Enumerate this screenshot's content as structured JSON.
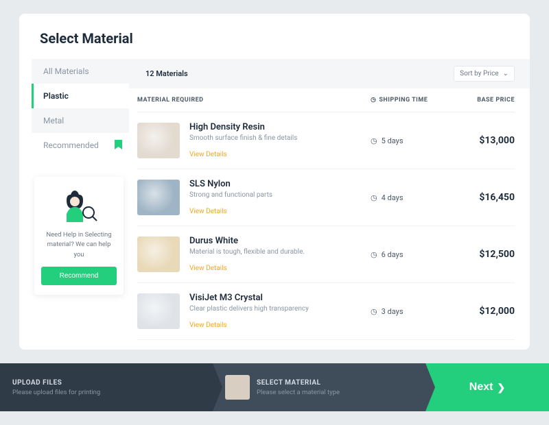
{
  "page_title": "Select Material",
  "sidebar": {
    "tabs": [
      {
        "label": "All Materials"
      },
      {
        "label": "Plastic"
      },
      {
        "label": "Metal"
      },
      {
        "label": "Recommended"
      }
    ],
    "help_text": "Need Help in Selecting material? We can help you",
    "recommend_label": "Recommend"
  },
  "list": {
    "count_label": "12 Materials",
    "sort_label": "Sort by Price",
    "columns": {
      "material": "MATERIAL REQUIRED",
      "shipping": "SHIPPING TIME",
      "price": "BASE PRICE"
    },
    "rows": [
      {
        "name": "High Density Resin",
        "desc": "Smooth surface finish & fine details",
        "view": "View Details",
        "ship": "5 days",
        "price": "$13,000"
      },
      {
        "name": "SLS Nylon",
        "desc": "Strong and functional parts",
        "view": "View Details",
        "ship": "4 days",
        "price": "$16,450"
      },
      {
        "name": "Durus White",
        "desc": "Material is tough, flexible and durable.",
        "view": "View Details",
        "ship": "6 days",
        "price": "$12,500"
      },
      {
        "name": "VisiJet M3 Crystal",
        "desc": "Clear plastic delivers high transparency",
        "view": "View Details",
        "ship": "3 days",
        "price": "$12,000"
      }
    ]
  },
  "stepper": {
    "step1_title": "UPLOAD FILES",
    "step1_sub": "Please upload files for printing",
    "step2_title": "SELECT MATERIAL",
    "step2_sub": "Please select a material type",
    "next_label": "Next"
  }
}
